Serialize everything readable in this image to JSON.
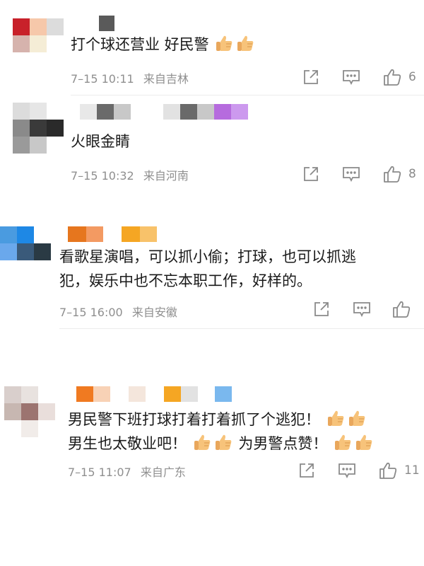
{
  "comments": [
    {
      "text_lines": [
        "打个球还营业 好民警"
      ],
      "text_emoji_count": 2,
      "time": "7–15 10:11",
      "location": "来自吉林",
      "like_count": "6",
      "avatar_colors": [
        "#c8212a",
        "#f6c8aa",
        "#dcdcdc",
        "#d6b3ad",
        "#f5edd6",
        "#ffffff"
      ],
      "name_colors": [
        "#ffffff",
        "#5a5a5a"
      ]
    },
    {
      "text_lines": [
        "火眼金睛"
      ],
      "text_emoji_count": 0,
      "time": "7–15 10:32",
      "location": "来自河南",
      "like_count": "8",
      "avatar_colors": [
        "#dcdcdc",
        "#e6e6e6",
        "#3a3a3a",
        "#8a8a8a",
        "#2a2a2a",
        "#ffffff"
      ],
      "name_colors": [
        "#e8e8e8",
        "#6a6a6a",
        "#c8c8c8",
        "#ffffff",
        "#d8d8d8",
        "#6a6a6a",
        "#c8c8c8",
        "#b66bde",
        "#cc99ee"
      ]
    },
    {
      "text_lines": [
        "看歌星演唱，可以抓小偷；打球，也可以抓逃",
        "犯，娱乐中也不忘本职工作，好样的。"
      ],
      "text_emoji_count": 0,
      "time": "7–15 16:00",
      "location": "来自安徽",
      "like_count": "",
      "avatar_colors": [
        "#4a9be0",
        "#1e88e5",
        "#6aa8ec",
        "#3a5a7a",
        "#2a3a44",
        "#ffffff"
      ],
      "name_colors": [
        "#e6761e",
        "#f39a62",
        "#ffffff",
        "#f5a623",
        "#f8c26a"
      ]
    },
    {
      "text_lines": [
        "男民警下班打球打着打着抓了个逃犯！",
        "男生也太敬业吧！",
        "为男警点赞！"
      ],
      "text_emoji_count": 2,
      "time": "7–15 11:07",
      "location": "来自广东",
      "like_count": "11",
      "avatar_colors": [
        "#d9cfcc",
        "#e8e2df",
        "#c7b7b1",
        "#9c7470",
        "#e9dedb",
        "#f1ece9"
      ],
      "name_colors": [
        "#f07a21",
        "#f8d2b6",
        "#f4e6dc",
        "#f5a623",
        "#e2e2e2",
        "#7ab8ee"
      ]
    }
  ],
  "icons": {
    "share": "share-icon",
    "comment": "comment-icon",
    "like": "thumbs-up-icon",
    "emoji": "thumbs-up-emoji"
  }
}
